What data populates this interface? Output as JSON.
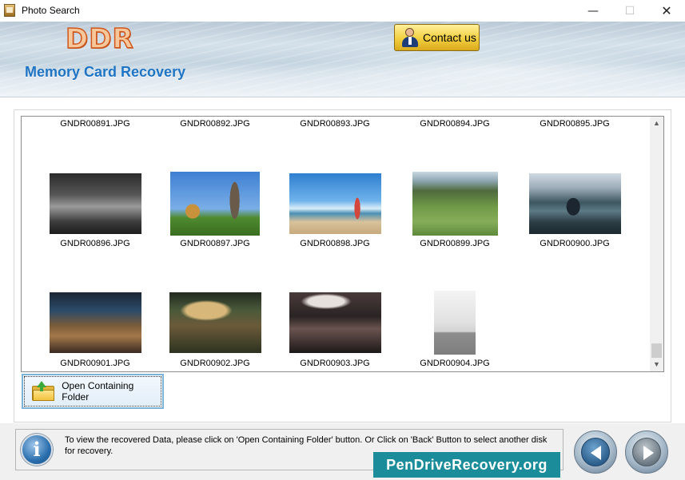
{
  "window": {
    "title": "Photo Search",
    "minimize_glyph": "—",
    "maximize_glyph": "☐",
    "close_glyph": "✕"
  },
  "header": {
    "logo": "DDR",
    "contact_label": "Contact us",
    "subtitle": "Memory Card Recovery"
  },
  "results": {
    "rows": [
      {
        "items": [
          {
            "name": "GNDR00891.JPG",
            "image": ""
          },
          {
            "name": "GNDR00892.JPG",
            "image": ""
          },
          {
            "name": "GNDR00893.JPG",
            "image": ""
          },
          {
            "name": "GNDR00894.JPG",
            "image": ""
          },
          {
            "name": "GNDR00895.JPG",
            "image": ""
          }
        ]
      },
      {
        "items": [
          {
            "name": "GNDR00896.JPG",
            "image": "bw-family-portrait"
          },
          {
            "name": "GNDR00897.JPG",
            "image": "child-eiffel-tower"
          },
          {
            "name": "GNDR00898.JPG",
            "image": "beach-lift-child"
          },
          {
            "name": "GNDR00899.JPG",
            "image": "park-picnic-crowd"
          },
          {
            "name": "GNDR00900.JPG",
            "image": "lake-mountains"
          }
        ]
      },
      {
        "items": [
          {
            "name": "GNDR00901.JPG",
            "image": "outdoor-dining-group"
          },
          {
            "name": "GNDR00902.JPG",
            "image": "street-band-night"
          },
          {
            "name": "GNDR00903.JPG",
            "image": "party-crowd"
          },
          {
            "name": "GNDR00904.JPG",
            "image": "grey-portrait"
          }
        ]
      }
    ]
  },
  "actions": {
    "open_folder_label": "Open Containing Folder"
  },
  "footer": {
    "info_text": "To view the recovered Data, please click on 'Open Containing Folder' button. Or Click on 'Back' Button to select another disk for recovery.",
    "info_glyph": "i",
    "watermark": "PenDriveRecovery.org"
  },
  "colors": {
    "accent": "#1f74c4",
    "contact_button": "#f2cf3f",
    "watermark_bg": "#1b8c9a"
  }
}
